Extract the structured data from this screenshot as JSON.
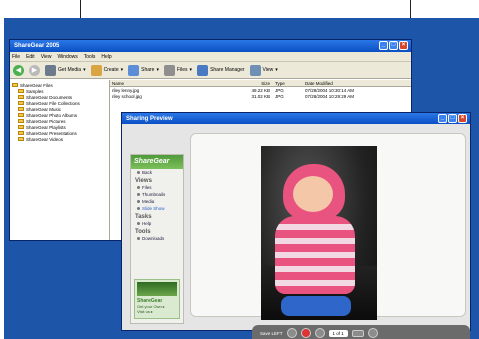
{
  "main_window": {
    "title": "ShareGear 2005",
    "menu": [
      "File",
      "Edit",
      "View",
      "Windows",
      "Tools",
      "Help"
    ],
    "toolbar": [
      {
        "label": "Get Media",
        "icon": "camera-icon"
      },
      {
        "label": "Create",
        "icon": "create-icon"
      },
      {
        "label": "Share",
        "icon": "share-icon"
      },
      {
        "label": "Files",
        "icon": "files-icon"
      },
      {
        "label": "Share Manager",
        "icon": "share-manager-icon"
      },
      {
        "label": "View",
        "icon": "view-icon"
      }
    ],
    "tree": {
      "root": "ShareGear Files",
      "items": [
        "Samples",
        "ShareGear Documents",
        "ShareGear File Collections",
        "ShareGear Music",
        "ShareGear Photo Albums",
        "ShareGear Pictures",
        "ShareGear Playlists",
        "ShareGear Presentations",
        "ShareGear Videos"
      ]
    },
    "file_list": {
      "columns": [
        "Name",
        "Size",
        "Type",
        "Date Modified"
      ],
      "rows": [
        {
          "name": "riley lenny.jpg",
          "size": "49.22 KB",
          "type": "JPG",
          "date": "07/28/2004 10:30:14 AM"
        },
        {
          "name": "riley school.jpg",
          "size": "31.02 KB",
          "type": "JPG",
          "date": "07/28/2004 10:29:29 AM"
        }
      ]
    }
  },
  "preview_window": {
    "title": "Sharing Preview",
    "sidebar": {
      "logo": "ShareGear",
      "back": "Back",
      "sections": [
        {
          "title": "Views",
          "links": [
            "Files",
            "Thumbnails",
            "Media",
            "Slide Show"
          ]
        },
        {
          "title": "Tasks",
          "links": [
            "Help"
          ]
        },
        {
          "title": "Tools",
          "links": [
            "Downloads"
          ]
        }
      ],
      "ad": {
        "brand": "ShareGear",
        "line1": "Get your Own ▸",
        "line2": "Visit us ▸"
      }
    },
    "controls": {
      "page": "1 of 1",
      "save": "Save LEFT"
    }
  }
}
